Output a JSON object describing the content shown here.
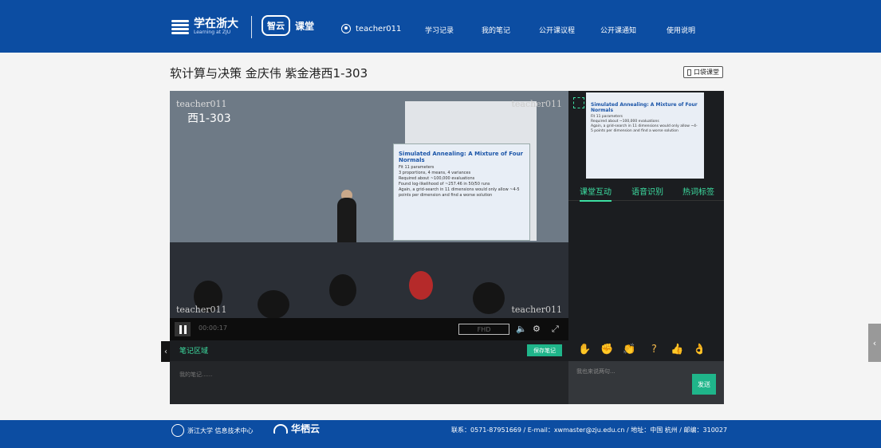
{
  "header": {
    "logo_main": "学在浙大",
    "logo_sub": "Learning at ZJU",
    "brand_badge": "智云",
    "brand_title": "课堂",
    "user": "teacher011",
    "nav": [
      "学习记录",
      "我的笔记",
      "公开课议程",
      "公开课通知",
      "使用说明"
    ]
  },
  "course": {
    "title": "软计算与决策 金庆伟 紫金港西1-303",
    "pocket_button": "口袋课堂"
  },
  "video": {
    "watermark": "teacher011",
    "room": "西1-303",
    "slide_title": "Simulated Annealing: A Mixture of Four Normals",
    "slide_lines": [
      "Fit 11 parameters",
      "3 proportions, 4 means, 4 variances",
      "Required about ~100,000 evaluations",
      "Found log-likelihood of ~257.46 in 50/50 runs",
      "Again, a grid-search in 11 dimensions would only allow ~4-5 points per dimension and find a worse solution"
    ],
    "time": "00:00:17",
    "quality": "FHD",
    "volume_icon": "volume-icon",
    "settings_icon": "gear-icon",
    "fullscreen_icon": "fullscreen-icon"
  },
  "side": {
    "tabs": [
      "课堂互动",
      "语音识别",
      "热词标签"
    ],
    "chat_placeholder": "我也来说两句...",
    "send": "发送",
    "emojis": [
      "✋",
      "✊",
      "👏",
      "?",
      "👍",
      "👌"
    ]
  },
  "notes": {
    "title": "笔记区域",
    "save": "保存笔记",
    "placeholder": "我的笔记......",
    "collapse_icon": "chevron-left-icon"
  },
  "footer": {
    "org": "浙江大学 信息技术中心",
    "partner": "华栖云",
    "contact": "联系：0571-87951669 / E-mail：xwmaster@zju.edu.cn / 地址：中国 杭州 / 邮编：310027"
  }
}
